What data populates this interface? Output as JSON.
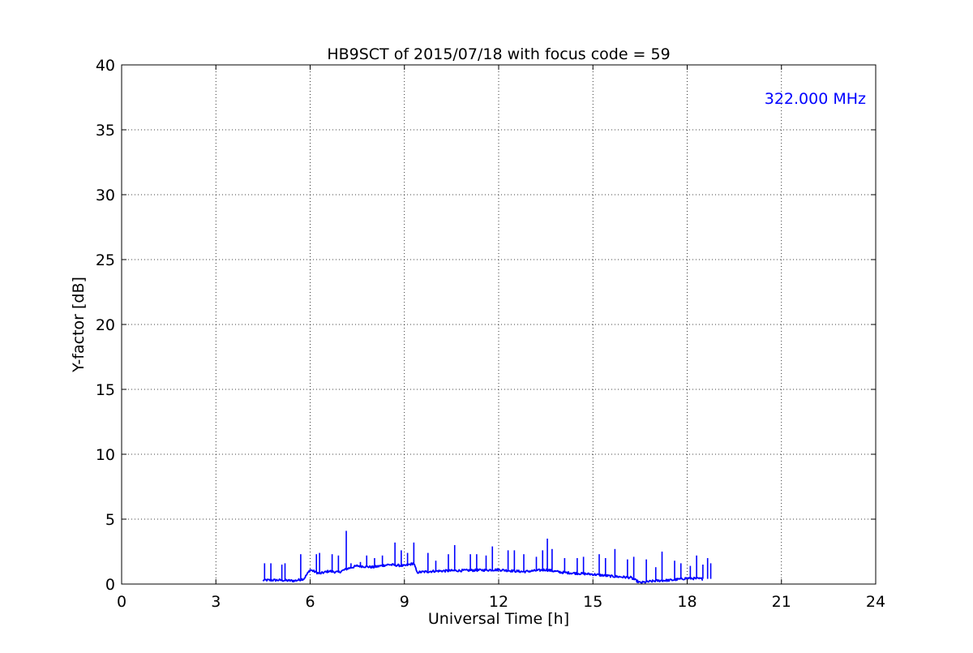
{
  "chart_data": {
    "type": "line",
    "title": "HB9SCT of 2015/07/18 with focus code = 59",
    "xlabel": "Universal Time [h]",
    "ylabel": "Y-factor [dB]",
    "xlim": [
      0,
      24
    ],
    "ylim": [
      0,
      40
    ],
    "xticks": [
      "0",
      "3",
      "6",
      "9",
      "12",
      "15",
      "18",
      "21",
      "24"
    ],
    "yticks": [
      "0",
      "5",
      "10",
      "15",
      "20",
      "25",
      "30",
      "35",
      "40"
    ],
    "grid": true,
    "annotation": "322.000 MHz",
    "annotation_position": "top-right",
    "colors": {
      "series": "#0000ff",
      "annotation": "#0000ff",
      "axes": "#000000",
      "grid": "#000000"
    },
    "series": [
      {
        "color": "#0000ff",
        "baseline": [
          [
            4.5,
            0.3
          ],
          [
            5.0,
            0.3
          ],
          [
            5.5,
            0.25
          ],
          [
            5.8,
            0.4
          ],
          [
            6.0,
            1.1
          ],
          [
            6.3,
            0.8
          ],
          [
            6.6,
            1.0
          ],
          [
            6.9,
            0.9
          ],
          [
            7.2,
            1.2
          ],
          [
            7.5,
            1.4
          ],
          [
            8.0,
            1.3
          ],
          [
            8.5,
            1.5
          ],
          [
            9.0,
            1.4
          ],
          [
            9.3,
            1.6
          ],
          [
            9.4,
            0.9
          ],
          [
            10.0,
            1.0
          ],
          [
            11.0,
            1.05
          ],
          [
            12.0,
            1.1
          ],
          [
            12.8,
            0.95
          ],
          [
            13.5,
            1.1
          ],
          [
            14.0,
            0.9
          ],
          [
            15.0,
            0.75
          ],
          [
            15.6,
            0.6
          ],
          [
            16.2,
            0.5
          ],
          [
            16.5,
            0.1
          ],
          [
            17.0,
            0.25
          ],
          [
            17.5,
            0.3
          ],
          [
            18.0,
            0.45
          ],
          [
            18.5,
            0.4
          ]
        ],
        "spikes": [
          [
            4.55,
            1.6
          ],
          [
            4.75,
            1.6
          ],
          [
            5.1,
            1.5
          ],
          [
            5.2,
            1.6
          ],
          [
            5.7,
            2.3
          ],
          [
            6.2,
            2.3
          ],
          [
            6.3,
            2.4
          ],
          [
            6.7,
            2.3
          ],
          [
            6.9,
            2.2
          ],
          [
            7.15,
            4.1
          ],
          [
            7.3,
            1.6
          ],
          [
            7.6,
            1.7
          ],
          [
            7.8,
            2.2
          ],
          [
            8.05,
            2.0
          ],
          [
            8.3,
            2.2
          ],
          [
            8.7,
            3.2
          ],
          [
            8.9,
            2.6
          ],
          [
            9.1,
            2.4
          ],
          [
            9.3,
            3.2
          ],
          [
            9.75,
            2.4
          ],
          [
            10.0,
            1.8
          ],
          [
            10.4,
            2.3
          ],
          [
            10.6,
            3.0
          ],
          [
            11.1,
            2.3
          ],
          [
            11.3,
            2.3
          ],
          [
            11.6,
            2.2
          ],
          [
            11.8,
            2.9
          ],
          [
            12.3,
            2.6
          ],
          [
            12.5,
            2.6
          ],
          [
            12.8,
            2.3
          ],
          [
            13.2,
            2.1
          ],
          [
            13.4,
            2.6
          ],
          [
            13.55,
            3.5
          ],
          [
            13.7,
            2.7
          ],
          [
            14.1,
            2.0
          ],
          [
            14.5,
            2.0
          ],
          [
            14.7,
            2.1
          ],
          [
            15.2,
            2.3
          ],
          [
            15.4,
            2.0
          ],
          [
            15.7,
            2.7
          ],
          [
            16.1,
            1.9
          ],
          [
            16.3,
            2.1
          ],
          [
            16.7,
            1.9
          ],
          [
            17.0,
            1.3
          ],
          [
            17.2,
            2.5
          ],
          [
            17.6,
            1.8
          ],
          [
            17.8,
            1.6
          ],
          [
            18.1,
            1.4
          ],
          [
            18.3,
            2.2
          ],
          [
            18.5,
            1.5
          ],
          [
            18.65,
            2.0
          ],
          [
            18.75,
            1.6
          ]
        ]
      }
    ]
  }
}
